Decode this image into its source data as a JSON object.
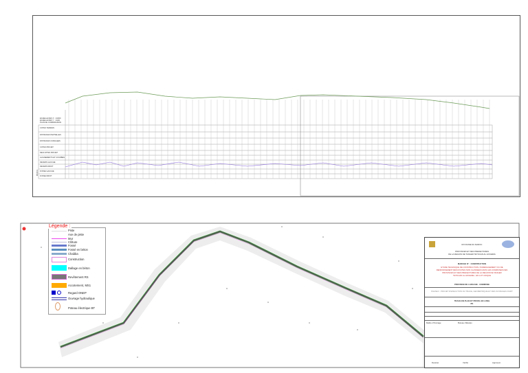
{
  "profile": {
    "header_lines": [
      "ECHELLE DES X : 1/1000",
      "ECHELLE DES Y : 1/100",
      "PLAN DE COMPARAISON"
    ],
    "rows": [
      "COTES TERRAIN",
      "DISTANCES PARTIELLES",
      "DISTANCES CUMULEES",
      "COTES PROJET",
      "DECLIVITES PROJET",
      "ALIGNEMENTS ET COURBES",
      "DEVERS GAUCHE",
      "DEVERS DROIT",
      "FOSSE GAUCHE",
      "FOSSE DROIT"
    ],
    "side_label": "PROFIL"
  },
  "legend": {
    "title": "Légende :",
    "items": [
      "Piste",
      "Axe de piste",
      "Mur",
      "Clôture",
      "Fossé",
      "Fossé en béton",
      "Chaâba",
      "Construction",
      "Dallage en béton",
      "Revêtement RS",
      "Accotement, MS1",
      "Regard ONEP",
      "Ouvrage hydraulique",
      "Poteau électrique BT"
    ]
  },
  "title_block": {
    "kingdom": "ROYAUME DU MAROC",
    "region_line1": "PROVINCES ET DES PREFECTURES",
    "region_line2": "DE LA REGION DE TANGER TETOUAN AL HOCEIMA",
    "market": "MARCHE N° : CONSTRUCTION",
    "study_lines": [
      "ETUDE TECHNIQUE DE CONSTRUCTION, D'AMENAGEMENT OU DE",
      "RENFORCEMENT DES ROUTES NON CLASSEES DANS LES COMMUNES DES",
      "PROVINCES ET DES PREFECTURES DE LA REGION DE TANGER",
      "TETOUAN AL HOCEIMA - EN LOT UNIQUE"
    ],
    "province": "PROVINCE DE LARACHE - COMMUNE",
    "lot": "PHASE II : PROJET D'EXECUTION DU TRACE, GEOMETRIQUE ET DES OUVRAGES D'ART",
    "drawing_title": "TRACE EN PLAN ET PROFIL EN LONG",
    "drawing_sub": "PK",
    "footer": [
      "Maître d'Ouvrage",
      "Bureau d'Etudes",
      "Dessiné",
      "Vérifié",
      "Approuvé"
    ]
  },
  "colors": {
    "road": "#555555",
    "accent_green": "#22cc22",
    "wall": "#ee44ee",
    "ditch": "#4466cc",
    "legend_title": "#ee1111"
  }
}
